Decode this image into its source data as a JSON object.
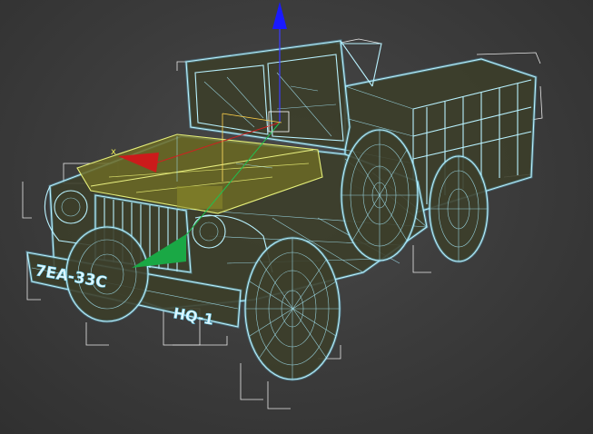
{
  "viewport": {
    "background": "#3a3a3a",
    "wireframe_color": "#b9f2ff",
    "selection_color": "#ffffff"
  },
  "model": {
    "front_plate": "7EA-33C",
    "bumper_plate": "HQ-1"
  },
  "gizmo": {
    "x_axis_color": "#cc1b1b",
    "y_axis_color": "#1aa845",
    "z_axis_color": "#1a1aff",
    "x_label": "x"
  }
}
